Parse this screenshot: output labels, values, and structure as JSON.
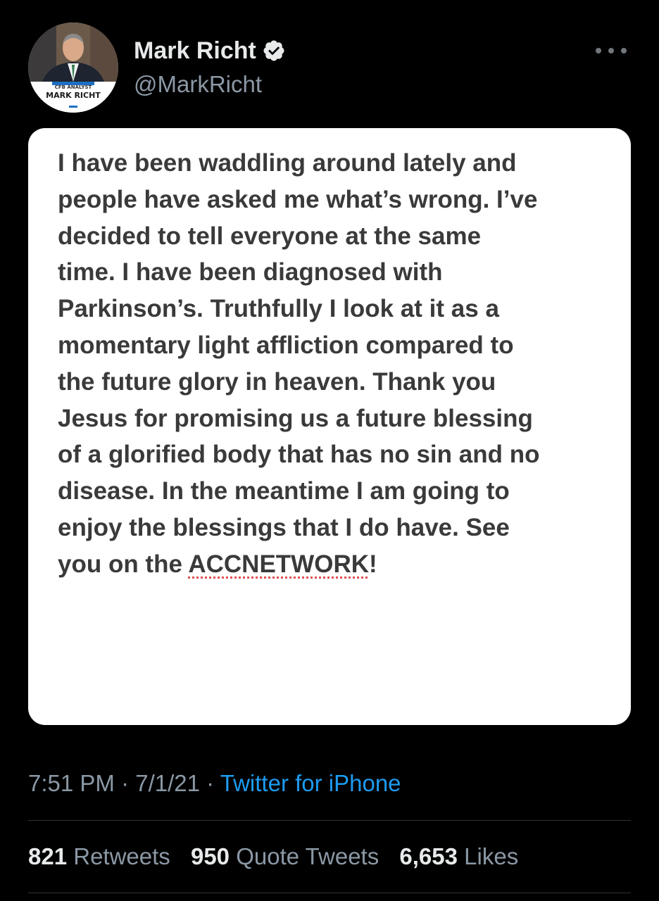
{
  "tweet": {
    "author": {
      "display_name": "Mark Richt",
      "handle": "@MarkRicht",
      "verified": true,
      "avatar": {
        "caption_top": "CFB ANALYST",
        "caption_name": "MARK RICHT"
      }
    },
    "more_icon": "more-horizontal-icon",
    "image_text": {
      "lines": [
        "I have been waddling around lately and",
        "people have asked me what’s wrong. I’ve",
        "decided to tell everyone at the same",
        "time. I have been diagnosed with",
        "Parkinson’s. Truthfully I look at it as a",
        "momentary light affliction compared to",
        "the future glory in heaven. Thank you",
        "Jesus for promising us a future blessing",
        "of a glorified body that has no sin and no",
        "disease. In the meantime I am going to",
        "enjoy the blessings that I do have. See"
      ],
      "last_line_prefix": "you on the ",
      "last_line_word": "ACCNETWORK",
      "last_line_suffix": "!"
    },
    "time": "7:51 PM",
    "date": "7/1/21",
    "separator": "·",
    "source": "Twitter for iPhone",
    "stats": {
      "retweets": {
        "count": "821",
        "label": "Retweets"
      },
      "quote_tweets": {
        "count": "950",
        "label": "Quote Tweets"
      },
      "likes": {
        "count": "6,653",
        "label": "Likes"
      }
    }
  },
  "colors": {
    "background": "#000000",
    "primary_text": "#e7e9ea",
    "secondary_text": "#8b98a5",
    "link": "#1d9bf0",
    "verified_badge": "#e7e9ea",
    "card_background": "#ffffff"
  }
}
